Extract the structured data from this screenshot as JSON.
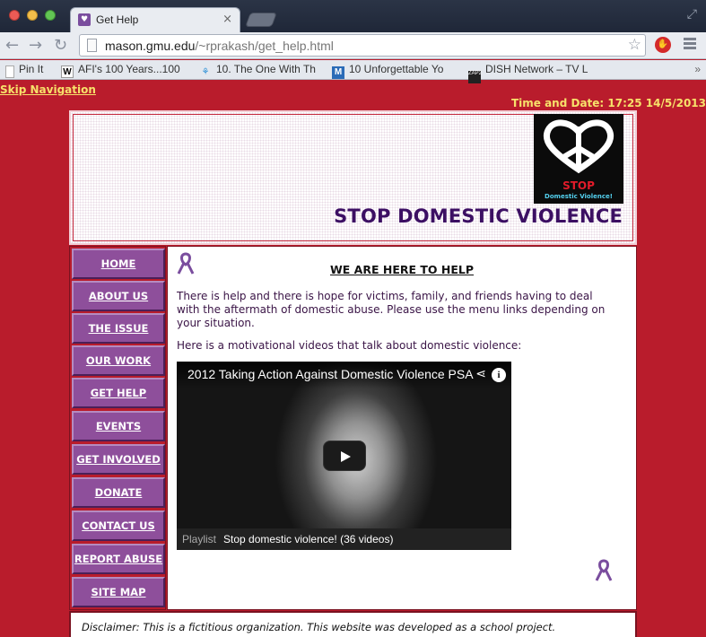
{
  "browser": {
    "tab_title": "Get Help",
    "url_domain": "mason.gmu.edu",
    "url_path": "/~rprakash/get_help.html",
    "bookmarks": [
      {
        "label": "Pin It",
        "icon": "pin-icon"
      },
      {
        "label": "AFI's 100 Years...100",
        "icon": "wikipedia-icon"
      },
      {
        "label": "10. The One With Th",
        "icon": "person-icon"
      },
      {
        "label": "10 Unforgettable Yo",
        "icon": "m-icon"
      },
      {
        "label": "DISH Network – TV L",
        "icon": "zap2it-icon"
      }
    ],
    "more_chevron": "»"
  },
  "page": {
    "skip_nav": "Skip Navigation",
    "datetime": "Time and Date: 17:25 14/5/2013",
    "banner_title": "STOP DOMESTIC VIOLENCE",
    "logo": {
      "stop": "STOP",
      "sub": "Domestic Violence!"
    },
    "nav": [
      "HOME",
      "ABOUT US",
      "THE ISSUE",
      "OUR WORK",
      "GET HELP",
      "EVENTS",
      "GET INVOLVED",
      "DONATE",
      "CONTACT US",
      "REPORT ABUSE",
      "SITE MAP"
    ],
    "content": {
      "heading": "WE ARE HERE TO HELP",
      "para1": "There is help and there is hope for victims, family, and friends having to deal with the aftermath of domestic abuse. Please use the menu links depending on your situation.",
      "para2": "Here is a motivational videos that talk about domestic violence:"
    },
    "video": {
      "title": "2012 Taking Action Against Domestic Violence PSA",
      "playlist_label": "Playlist",
      "playlist_title": "Stop domestic violence! (36 videos)"
    },
    "disclaimer": "Disclaimer: This is a fictitious organization. This website was developed as a school project."
  },
  "colors": {
    "page_bg": "#b91c2c",
    "nav_purple": "#8e4f9b",
    "title_purple": "#3c0f63",
    "highlight_yellow": "#f7e16a"
  }
}
